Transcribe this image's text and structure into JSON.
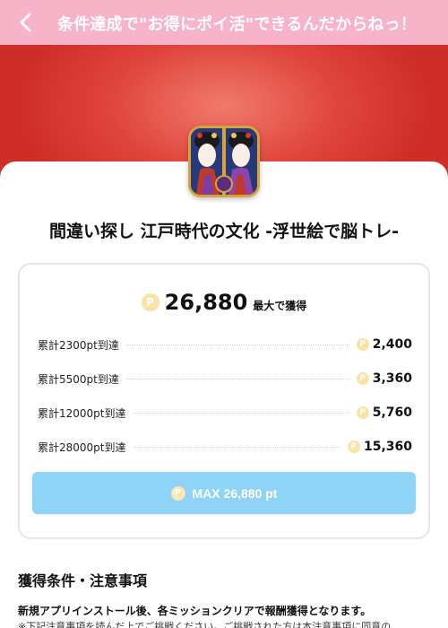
{
  "header": {
    "title": "条件達成で\"お得にポイ活\"できるんだからねっ！",
    "back_icon": "chevron-left-icon"
  },
  "colors": {
    "header_bg": "#f7b3c8",
    "hero_red": "#e0453c",
    "button_blue": "#8fd3f6",
    "coin_gold": "#fbe3a6"
  },
  "app": {
    "title": "間違い探し 江戸時代の文化 -浮世絵で脳トレ-"
  },
  "reward": {
    "coin_symbol": "P",
    "total_value": "26,880",
    "total_suffix": "最大で獲得",
    "tiers": [
      {
        "label": "累計2300pt到達",
        "value": "2,400"
      },
      {
        "label": "累計5500pt到達",
        "value": "3,360"
      },
      {
        "label": "累計12000pt到達",
        "value": "5,760"
      },
      {
        "label": "累計28000pt到達",
        "value": "15,360"
      }
    ],
    "max_button_label": "MAX 26,880 pt"
  },
  "conditions": {
    "heading": "獲得条件・注意事項",
    "bold_text": "新規アプリインストール後、各ミッションクリアで報酬獲得となります。",
    "note_text": "※下記注意事項を読んだ上でご挑戦ください。ご挑戦された方は本注意事項に同意の"
  }
}
